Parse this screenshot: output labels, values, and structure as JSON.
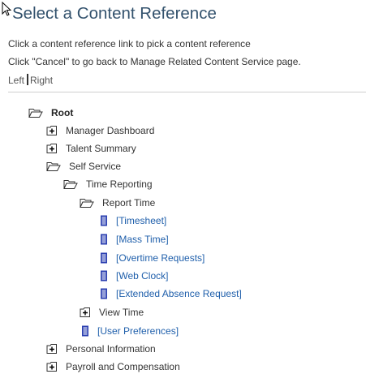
{
  "header": {
    "title": "Select a Content Reference",
    "instruction_1": "Click a content reference link to pick a content reference",
    "instruction_2": "Click \"Cancel\" to go back to Manage Related Content Service page.",
    "left_label": "Left",
    "right_label": "Right"
  },
  "tree": {
    "root": "Root",
    "manager_dashboard": "Manager Dashboard",
    "talent_summary": "Talent Summary",
    "self_service": "Self Service",
    "time_reporting": "Time Reporting",
    "report_time": "Report Time",
    "timesheet": "[Timesheet]",
    "mass_time": "[Mass Time]",
    "overtime_requests": "[Overtime Requests]",
    "web_clock": "[Web Clock]",
    "extended_absence_request": "[Extended Absence Request]",
    "view_time": "View Time",
    "user_preferences": "[User Preferences]",
    "personal_information": "Personal Information",
    "payroll_and_compensation": "Payroll and Compensation"
  },
  "icons": {
    "open_folder": "open-folder-icon",
    "expand": "expand-plus-icon",
    "document": "document-icon",
    "cursor": "mouse-pointer-icon"
  },
  "colors": {
    "title": "#33526d",
    "link": "#1f5fab",
    "text": "#333333",
    "document_icon": "#2b3fb0"
  }
}
